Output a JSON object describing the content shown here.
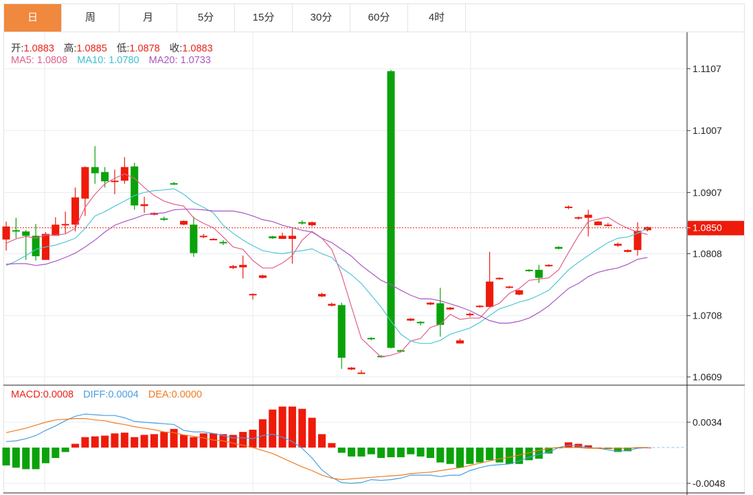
{
  "tabs": [
    {
      "label": "日",
      "active": true
    },
    {
      "label": "周"
    },
    {
      "label": "月"
    },
    {
      "label": "5分"
    },
    {
      "label": "15分"
    },
    {
      "label": "30分"
    },
    {
      "label": "60分"
    },
    {
      "label": "4时"
    }
  ],
  "ohlc_legend": {
    "open_label": "开:",
    "open": "1.0883",
    "high_label": "高:",
    "high": "1.0885",
    "low_label": "低:",
    "low": "1.0878",
    "close_label": "收:",
    "close": "1.0883"
  },
  "ma_legend": {
    "ma5_label": "MA5:",
    "ma5": "1.0808",
    "ma10_label": "MA10:",
    "ma10": "1.0780",
    "ma20_label": "MA20:",
    "ma20": "1.0733"
  },
  "macd_legend": {
    "macd_label": "MACD:",
    "macd": "0.0008",
    "diff_label": "DIFF:",
    "diff": "0.0004",
    "dea_label": "DEA:",
    "dea": "0.0000"
  },
  "colors": {
    "up": "#ee1b0b",
    "down": "#0aa20a",
    "ma5": "#e0608a",
    "ma10": "#4fc7d4",
    "ma20": "#a857c0",
    "diff": "#4a9de0",
    "dea": "#f07b20",
    "tab_active": "#f0883e"
  },
  "chart_data": [
    {
      "type": "candlestick",
      "title": "K-line (daily)",
      "y_ticks": [
        "1.1107",
        "1.1007",
        "1.0907",
        "1.0808",
        "1.0708",
        "1.0609"
      ],
      "ylim": [
        1.0609,
        1.1107
      ],
      "current_price": "1.0850",
      "candles": [
        [
          1.0831,
          1.086,
          1.0813,
          1.0852
        ],
        [
          1.0846,
          1.0866,
          1.0833,
          1.0844
        ],
        [
          1.0844,
          1.0846,
          1.0798,
          1.0837
        ],
        [
          1.0837,
          1.0856,
          1.0797,
          1.0804
        ],
        [
          1.0798,
          1.0843,
          1.0798,
          1.084
        ],
        [
          1.0837,
          1.0867,
          1.0837,
          1.0855
        ],
        [
          1.0854,
          1.0876,
          1.0841,
          1.0856
        ],
        [
          1.0855,
          1.0915,
          1.0844,
          1.0899
        ],
        [
          1.0897,
          1.0949,
          1.0869,
          1.0948
        ],
        [
          1.0948,
          1.0982,
          1.0921,
          1.0938
        ],
        [
          1.094,
          1.0948,
          1.0915,
          1.0925
        ],
        [
          1.0925,
          1.0944,
          1.0904,
          1.0926
        ],
        [
          1.0926,
          1.0964,
          1.0921,
          1.0948
        ],
        [
          1.0949,
          1.0955,
          1.0879,
          1.0886
        ],
        [
          1.0885,
          1.09,
          1.0874,
          1.0888
        ],
        [
          1.0871,
          1.0875,
          1.087,
          1.0874
        ],
        [
          1.0865,
          1.0868,
          1.0861,
          1.0864
        ],
        [
          1.0922,
          1.0924,
          1.0919,
          1.0921
        ],
        [
          1.0855,
          1.0862,
          1.0854,
          1.0861
        ],
        [
          1.0855,
          1.0868,
          1.0803,
          1.0809
        ],
        [
          1.0835,
          1.084,
          1.0833,
          1.0837
        ],
        [
          1.0831,
          1.0833,
          1.083,
          1.0832
        ],
        [
          1.0827,
          1.083,
          1.0822,
          1.0826
        ],
        [
          1.0785,
          1.079,
          1.0783,
          1.0788
        ],
        [
          1.0786,
          1.0805,
          1.0768,
          1.079
        ],
        [
          1.0742,
          1.0744,
          1.0734,
          1.0743
        ],
        [
          1.0769,
          1.0774,
          1.0768,
          1.0773
        ],
        [
          1.0836,
          1.0837,
          1.0832,
          1.0833
        ],
        [
          1.0832,
          1.0842,
          1.0832,
          1.0837
        ],
        [
          1.0832,
          1.0849,
          1.0792,
          1.0837
        ],
        [
          1.0859,
          1.0862,
          1.0855,
          1.0857
        ],
        [
          1.0854,
          1.086,
          1.0852,
          1.0859
        ],
        [
          1.0739,
          1.0745,
          1.0738,
          1.0743
        ],
        [
          1.0724,
          1.0729,
          1.0723,
          1.0727
        ],
        [
          1.0725,
          1.0729,
          1.0622,
          1.064
        ],
        [
          1.0621,
          1.0625,
          1.062,
          1.0624
        ],
        [
          1.0615,
          1.062,
          1.0614,
          1.0616
        ],
        [
          1.0672,
          1.0673,
          1.0668,
          1.0671
        ],
        [
          1.0643,
          1.0644,
          1.064,
          1.0641
        ],
        [
          1.1103,
          1.1105,
          1.0655,
          1.0656
        ],
        [
          1.0652,
          1.0653,
          1.0649,
          1.065
        ],
        [
          1.07,
          1.0704,
          1.0699,
          1.0703
        ],
        [
          1.0698,
          1.0699,
          1.0692,
          1.0696
        ],
        [
          1.0726,
          1.073,
          1.0725,
          1.0729
        ],
        [
          1.0728,
          1.0753,
          1.0674,
          1.0693
        ],
        [
          1.0718,
          1.0722,
          1.0717,
          1.0721
        ],
        [
          1.0663,
          1.0671,
          1.0663,
          1.0668
        ],
        [
          1.0709,
          1.0713,
          1.0706,
          1.0711
        ],
        [
          1.0722,
          1.0725,
          1.0721,
          1.0724
        ],
        [
          1.0722,
          1.0811,
          1.0722,
          1.0763
        ],
        [
          1.0767,
          1.077,
          1.0766,
          1.0769
        ],
        [
          1.0753,
          1.0756,
          1.0752,
          1.0755
        ],
        [
          1.0742,
          1.075,
          1.0741,
          1.0749
        ],
        [
          1.0782,
          1.0783,
          1.0779,
          1.078
        ],
        [
          1.0782,
          1.079,
          1.0761,
          1.0769
        ],
        [
          1.0788,
          1.0791,
          1.0787,
          1.079
        ],
        [
          1.0819,
          1.082,
          1.0815,
          1.0816
        ],
        [
          1.0883,
          1.0886,
          1.088,
          1.0884
        ],
        [
          1.0866,
          1.0868,
          1.0863,
          1.0867
        ],
        [
          1.0866,
          1.0879,
          1.0836,
          1.0871
        ],
        [
          1.0854,
          1.0861,
          1.0854,
          1.086
        ],
        [
          1.0853,
          1.0858,
          1.0852,
          1.0855
        ],
        [
          1.0821,
          1.0826,
          1.0819,
          1.0824
        ],
        [
          1.0811,
          1.0815,
          1.081,
          1.0814
        ],
        [
          1.0814,
          1.0859,
          1.0805,
          1.0845
        ],
        [
          1.0846,
          1.0852,
          1.0844,
          1.0851
        ]
      ],
      "candle_fields": [
        "open",
        "high",
        "low",
        "close"
      ],
      "series": [
        {
          "name": "MA5",
          "values": [
            1.0825,
            1.0832,
            1.0836,
            1.0833,
            1.0838,
            1.0838,
            1.084,
            1.0849,
            1.0883,
            1.0904,
            1.0921,
            1.093,
            1.0937,
            1.093,
            1.0915,
            1.0902,
            1.0893,
            1.0888,
            1.0885,
            1.0866,
            1.0857,
            1.085,
            1.0835,
            1.0819,
            1.0815,
            1.0797,
            1.0785,
            1.0785,
            1.0793,
            1.0805,
            1.083,
            1.0844,
            1.0833,
            1.0815,
            1.0774,
            1.0722,
            1.0671,
            1.0656,
            1.0641,
            1.0644,
            1.0649,
            1.0667,
            1.0671,
            1.0689,
            1.0694,
            1.071,
            1.0702,
            1.0704,
            1.0704,
            1.0721,
            1.0728,
            1.0744,
            1.0752,
            1.0765,
            1.0767,
            1.0769,
            1.0782,
            1.081,
            1.0837,
            1.086,
            1.0864,
            1.0867,
            1.0857,
            1.0849,
            1.0843,
            1.0839
          ]
        },
        {
          "name": "MA10",
          "values": [
            1.0789,
            1.0796,
            1.0805,
            1.0815,
            1.0819,
            1.0822,
            1.0827,
            1.0833,
            1.0849,
            1.0869,
            1.0876,
            1.0885,
            1.0893,
            1.0902,
            1.0907,
            1.091,
            1.0911,
            1.0913,
            1.0904,
            1.0891,
            1.0883,
            1.0874,
            1.0854,
            1.0841,
            1.083,
            1.0821,
            1.0813,
            1.081,
            1.0808,
            1.0811,
            1.0813,
            1.0816,
            1.0808,
            1.0802,
            1.0785,
            1.0774,
            1.076,
            1.0741,
            1.0722,
            1.0699,
            1.0678,
            1.0667,
            1.0663,
            1.0663,
            1.0668,
            1.0678,
            1.0683,
            1.0688,
            1.0697,
            1.0708,
            1.0719,
            1.0724,
            1.073,
            1.0734,
            1.0741,
            1.0749,
            1.0765,
            1.0782,
            1.0794,
            1.0805,
            1.0816,
            1.0826,
            1.0833,
            1.0835,
            1.0841,
            1.0849
          ]
        },
        {
          "name": "MA20",
          "values": [
            1.0791,
            1.0792,
            1.0792,
            1.0789,
            1.0791,
            1.0796,
            1.0802,
            1.0809,
            1.0819,
            1.083,
            1.0843,
            1.0854,
            1.086,
            1.0865,
            1.0871,
            1.0873,
            1.0874,
            1.0879,
            1.088,
            1.088,
            1.0879,
            1.0877,
            1.0877,
            1.0877,
            1.0874,
            1.0869,
            1.0863,
            1.086,
            1.0854,
            1.085,
            1.0846,
            1.0843,
            1.0833,
            1.0826,
            1.0815,
            1.0804,
            1.0789,
            1.0777,
            1.0765,
            1.0758,
            1.0749,
            1.0741,
            1.0735,
            1.0735,
            1.0732,
            1.0727,
            1.0722,
            1.0716,
            1.0708,
            1.07,
            1.0696,
            1.0696,
            1.0699,
            1.0704,
            1.0713,
            1.0724,
            1.0738,
            1.0752,
            1.076,
            1.0771,
            1.0778,
            1.0782,
            1.0785,
            1.0791,
            1.0799,
            1.0802
          ]
        }
      ]
    },
    {
      "type": "bar",
      "title": "MACD",
      "y_ticks": [
        "0.0034",
        "-0.0048"
      ],
      "ylim": [
        -0.0048,
        0.0034
      ],
      "macd": [
        -0.0024,
        -0.0027,
        -0.0029,
        -0.0029,
        -0.0021,
        -0.0014,
        -0.0006,
        0.0005,
        0.0014,
        0.0015,
        0.0016,
        0.0019,
        0.002,
        0.0014,
        0.0017,
        0.0018,
        0.0021,
        0.0025,
        0.0017,
        0.0014,
        0.0019,
        0.0019,
        0.0018,
        0.0017,
        0.0021,
        0.0024,
        0.0038,
        0.0051,
        0.0055,
        0.0055,
        0.0052,
        0.004,
        0.0018,
        0.0006,
        -0.0007,
        -0.0012,
        -0.0012,
        -0.0009,
        -0.0014,
        -0.0013,
        -0.0013,
        -0.0009,
        -0.0012,
        -0.0014,
        -0.002,
        -0.0022,
        -0.0027,
        -0.0022,
        -0.002,
        -0.0017,
        -0.002,
        -0.0022,
        -0.0022,
        -0.0017,
        -0.0015,
        -0.0008,
        -0.0001,
        0.0007,
        0.0005,
        0.0003,
        0.0,
        -0.0002,
        -0.0006,
        -0.0005,
        -0.0001,
        0.0
      ],
      "series": [
        {
          "name": "DIFF",
          "values": [
            0.0008,
            0.0009,
            0.0012,
            0.0016,
            0.0023,
            0.0029,
            0.0036,
            0.0042,
            0.0045,
            0.0044,
            0.0043,
            0.0043,
            0.004,
            0.0035,
            0.0034,
            0.0033,
            0.0032,
            0.0031,
            0.0023,
            0.0021,
            0.0021,
            0.0019,
            0.0016,
            0.0013,
            0.0013,
            0.0012,
            0.0016,
            0.0018,
            0.0014,
            0.0008,
            -0.0001,
            -0.0014,
            -0.003,
            -0.004,
            -0.0047,
            -0.0048,
            -0.0047,
            -0.0043,
            -0.0044,
            -0.0043,
            -0.0041,
            -0.0037,
            -0.0037,
            -0.0037,
            -0.0039,
            -0.0037,
            -0.0037,
            -0.0031,
            -0.0027,
            -0.0024,
            -0.0023,
            -0.0022,
            -0.0018,
            -0.0013,
            -0.0009,
            -0.0006,
            0.0,
            0.0003,
            0.0002,
            0.0,
            -0.0001,
            -0.0003,
            -0.0005,
            -0.0004,
            -0.0001,
            0.0
          ]
        },
        {
          "name": "DEA",
          "values": [
            0.002,
            0.0023,
            0.0026,
            0.003,
            0.0034,
            0.0037,
            0.0038,
            0.0039,
            0.0039,
            0.0037,
            0.0036,
            0.0033,
            0.0031,
            0.0028,
            0.0026,
            0.0024,
            0.0021,
            0.002,
            0.0017,
            0.0015,
            0.0013,
            0.001,
            0.0009,
            0.0006,
            0.0003,
            0.0,
            -0.0004,
            -0.0008,
            -0.0014,
            -0.002,
            -0.0026,
            -0.0031,
            -0.0037,
            -0.0041,
            -0.0043,
            -0.0042,
            -0.0041,
            -0.004,
            -0.0039,
            -0.0038,
            -0.0037,
            -0.0035,
            -0.0034,
            -0.0033,
            -0.0031,
            -0.0029,
            -0.0027,
            -0.0024,
            -0.0021,
            -0.0018,
            -0.0015,
            -0.0013,
            -0.001,
            -0.0007,
            -0.0004,
            -0.0001,
            0.0,
            0.0,
            0.0,
            -0.0001,
            -0.0001,
            -0.0001,
            -0.0001,
            -0.0001,
            0.0,
            0.0
          ]
        }
      ]
    }
  ]
}
